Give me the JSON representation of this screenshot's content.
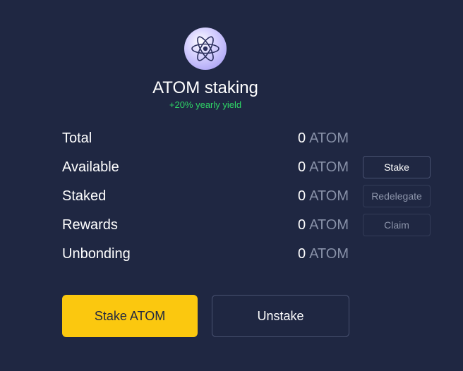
{
  "header": {
    "icon": "cosmos-atom-icon",
    "title": "ATOM staking",
    "yield_text": "+20% yearly yield"
  },
  "rows": [
    {
      "label": "Total",
      "amount": "0",
      "unit": "ATOM"
    },
    {
      "label": "Available",
      "amount": "0",
      "unit": "ATOM",
      "button": "Stake",
      "button_enabled": true
    },
    {
      "label": "Staked",
      "amount": "0",
      "unit": "ATOM",
      "button": "Redelegate",
      "button_enabled": false
    },
    {
      "label": "Rewards",
      "amount": "0",
      "unit": "ATOM",
      "button": "Claim",
      "button_enabled": false
    },
    {
      "label": "Unbonding",
      "amount": "0",
      "unit": "ATOM"
    }
  ],
  "actions": {
    "primary_label": "Stake ATOM",
    "secondary_label": "Unstake"
  },
  "colors": {
    "background": "#1f2742",
    "accent": "#fbc80f",
    "yield_green": "#2fd566",
    "muted_text": "#8891a8",
    "border": "#485170"
  }
}
